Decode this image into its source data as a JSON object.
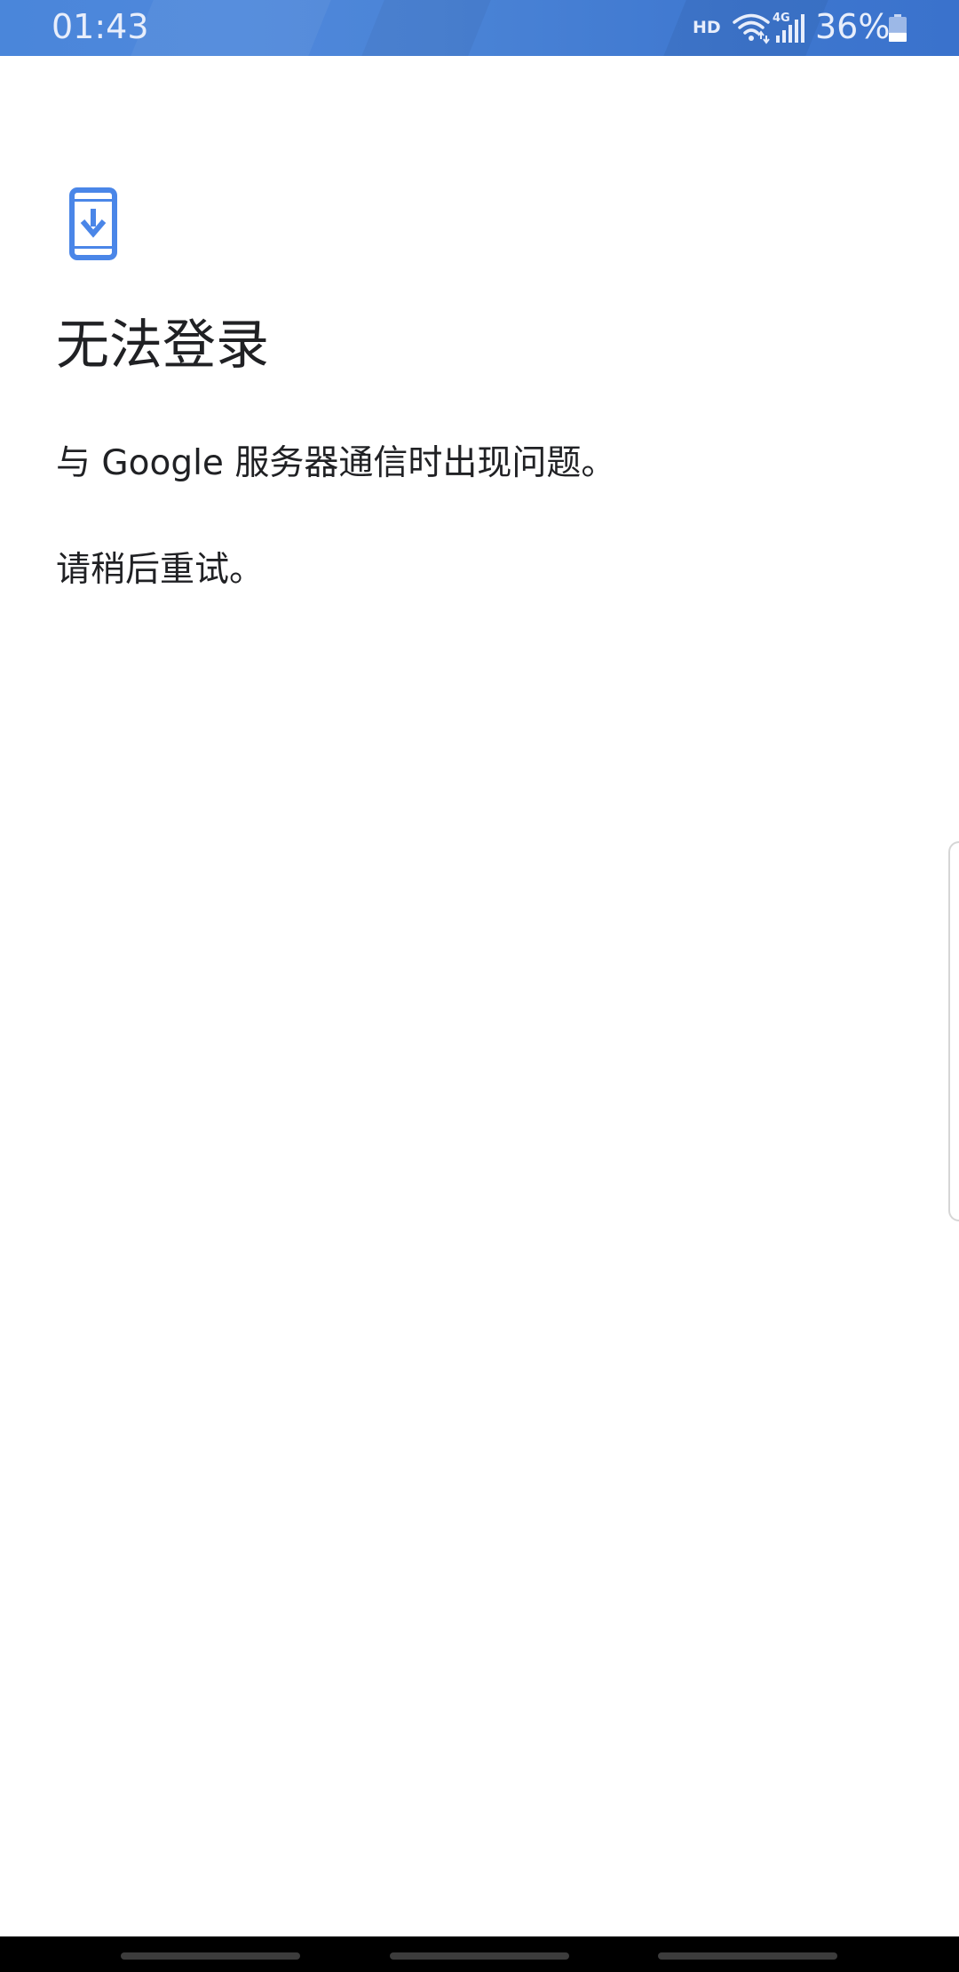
{
  "status_bar": {
    "time": "01:43",
    "hd_label": "HD",
    "network_label": "4G",
    "battery_percent": "36%",
    "battery_level": 0.36,
    "background_color": "#4a86da"
  },
  "screen": {
    "icon": "phone-download-icon",
    "icon_color": "#4a86e8",
    "title": "无法登录",
    "message": "与 Google 服务器通信时出现问题。",
    "retry_hint": "请稍后重试。"
  },
  "nav_bar": {
    "items": [
      "recent-apps",
      "home",
      "back"
    ]
  }
}
